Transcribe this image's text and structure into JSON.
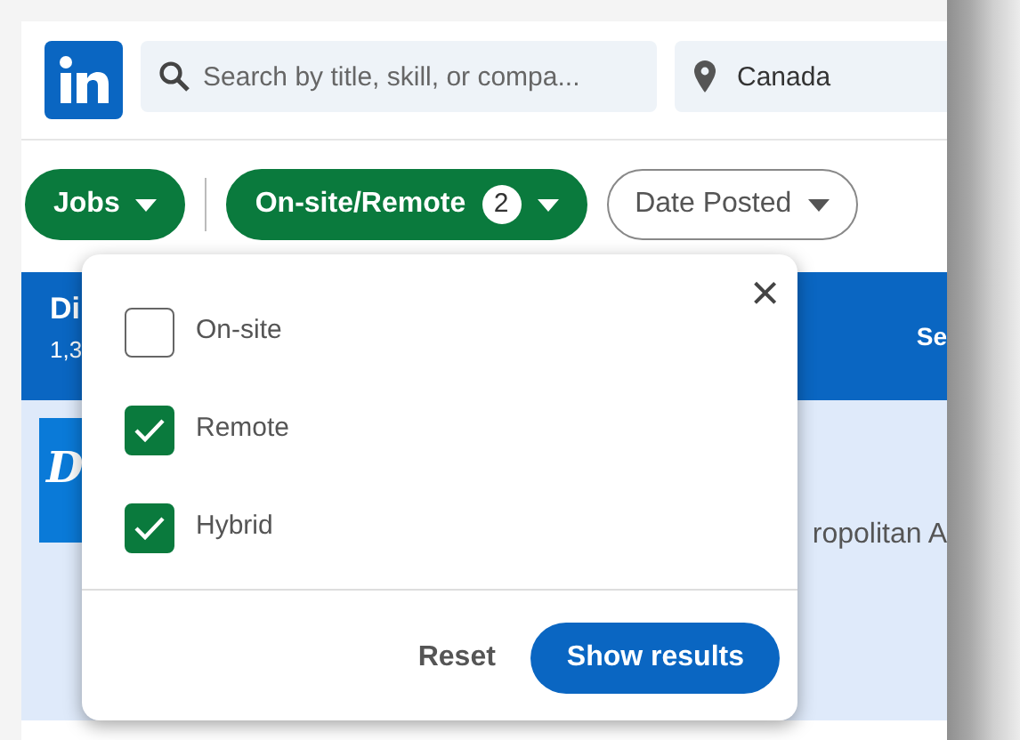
{
  "header": {
    "search": {
      "placeholder": "Search by title, skill, or compa..."
    },
    "location": {
      "value": "Canada"
    }
  },
  "filters": [
    {
      "label": "Jobs",
      "active": true
    },
    {
      "label": "On-site/Remote",
      "active": true,
      "badge": "2"
    },
    {
      "label": "Date Posted",
      "active": false
    }
  ],
  "results_header": {
    "title": "Di",
    "count": "1,3",
    "action": "Se"
  },
  "job_card": {
    "logo_letter": "D",
    "location": "ropolitan A"
  },
  "dropdown": {
    "close": "×",
    "options": [
      {
        "label": "On-site",
        "checked": false
      },
      {
        "label": "Remote",
        "checked": true
      },
      {
        "label": "Hybrid",
        "checked": true
      }
    ],
    "reset": "Reset",
    "submit": "Show results"
  }
}
